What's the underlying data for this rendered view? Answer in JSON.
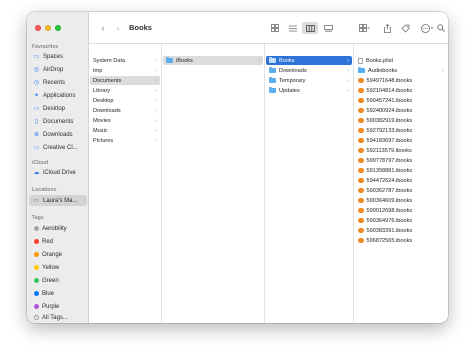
{
  "window": {
    "title": "Books"
  },
  "sidebar": {
    "favourites_heading": "Favourites",
    "favourites": [
      {
        "label": "Spaces",
        "icon": "folder-icon"
      },
      {
        "label": "AirDrop",
        "icon": "airdrop-icon"
      },
      {
        "label": "Recents",
        "icon": "clock-icon"
      },
      {
        "label": "Applications",
        "icon": "applications-icon"
      },
      {
        "label": "Desktop",
        "icon": "desktop-icon"
      },
      {
        "label": "Documents",
        "icon": "document-icon"
      },
      {
        "label": "Downloads",
        "icon": "download-icon"
      },
      {
        "label": "Creative Cl...",
        "icon": "folder-icon"
      }
    ],
    "icloud_heading": "iCloud",
    "icloud": [
      {
        "label": "iCloud Drive",
        "icon": "cloud-icon"
      }
    ],
    "locations_heading": "Locations",
    "locations": [
      {
        "label": "Laura's Ma...",
        "icon": "laptop-icon"
      }
    ],
    "tags_heading": "Tags",
    "tags": [
      {
        "label": "Aerobility",
        "color": "#a6a6a6"
      },
      {
        "label": "Red",
        "color": "#ff3b30"
      },
      {
        "label": "Orange",
        "color": "#ff9500"
      },
      {
        "label": "Yellow",
        "color": "#ffcc00"
      },
      {
        "label": "Green",
        "color": "#34c759"
      },
      {
        "label": "Blue",
        "color": "#007aff"
      },
      {
        "label": "Purple",
        "color": "#af52de"
      },
      {
        "label": "All Tags...",
        "color": ""
      }
    ]
  },
  "toolbar": {
    "back_icon": "chevron-left-icon",
    "forward_icon": "chevron-right-icon",
    "view_modes": [
      "icon-view",
      "list-view",
      "column-view",
      "gallery-view"
    ],
    "active_view": "column-view"
  },
  "columns": {
    "col1": [
      "System Data",
      "tmp",
      "Documents",
      "Library",
      "Desktop",
      "Downloads",
      "Movies",
      "Music",
      "Pictures"
    ],
    "col1_selected": "Documents",
    "col2": [
      "iBooks"
    ],
    "col2_selected": "iBooks",
    "col3": [
      "Books",
      "Downloads",
      "Temporary",
      "Updates"
    ],
    "col3_selected": "Books",
    "col4": [
      "Books.plist",
      "Audiobooks",
      "594971648.ibooks",
      "592104814.ibooks",
      "590457241.ibooks",
      "592400924.ibooks",
      "590382919.ibooks",
      "592792133.ibooks",
      "594183697.ibooks",
      "592113579.ibooks",
      "599778797.ibooks",
      "591358881.ibooks",
      "594472624.ibooks",
      "590362787.ibooks",
      "590364609.ibooks",
      "599012698.ibooks",
      "590364976.ibooks",
      "590383391.ibooks",
      "596872565.ibooks"
    ]
  },
  "colors": {
    "accent": "#2f73d9",
    "sidebar_bg": "#ececec",
    "folder": "#5aaef0",
    "ibooks": "#f08a24"
  }
}
